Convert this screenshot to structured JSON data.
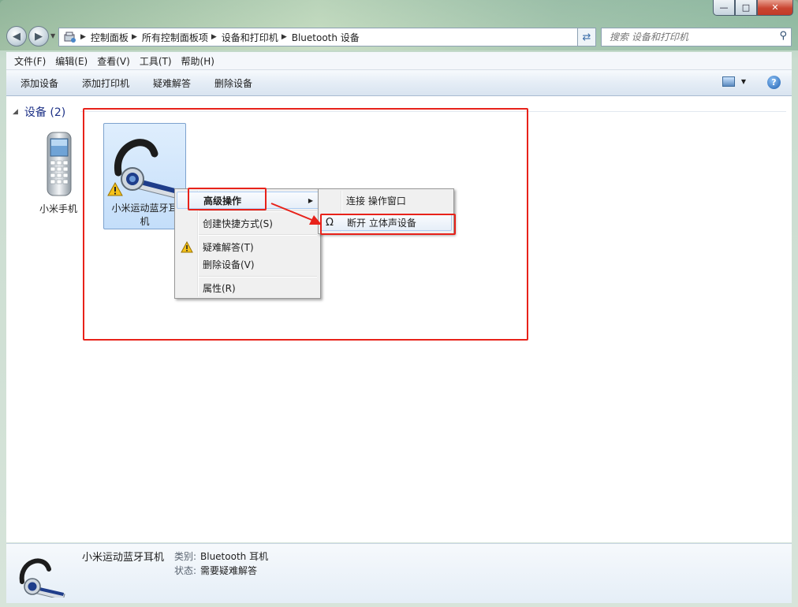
{
  "window": {
    "min_icon": "minimize-icon",
    "max_icon": "maximize-icon",
    "close_icon": "close-icon"
  },
  "address": {
    "segments": [
      "控制面板",
      "所有控制面板项",
      "设备和打印机",
      "Bluetooth 设备"
    ]
  },
  "search": {
    "placeholder": "搜索 设备和打印机"
  },
  "menu": [
    "文件(F)",
    "编辑(E)",
    "查看(V)",
    "工具(T)",
    "帮助(H)"
  ],
  "toolbar": [
    "添加设备",
    "添加打印机",
    "疑难解答",
    "删除设备"
  ],
  "group": {
    "title": "设备 (2)"
  },
  "devices": [
    {
      "name": "小米手机"
    },
    {
      "name_line1": "小米运动蓝牙耳",
      "name_line2": "机"
    }
  ],
  "context_menu": {
    "items": [
      "高级操作",
      "创建快捷方式(S)",
      "疑难解答(T)",
      "删除设备(V)",
      "属性(R)"
    ]
  },
  "submenu": {
    "items": [
      "连接 操作窗口",
      "断开 立体声设备"
    ]
  },
  "details": {
    "device_name": "小米运动蓝牙耳机",
    "category_label": "类别:",
    "category_value": "Bluetooth 耳机",
    "status_label": "状态:",
    "status_value": "需要疑难解答"
  },
  "colors": {
    "highlight": "#e8221a",
    "link_blue": "#1e3287"
  }
}
